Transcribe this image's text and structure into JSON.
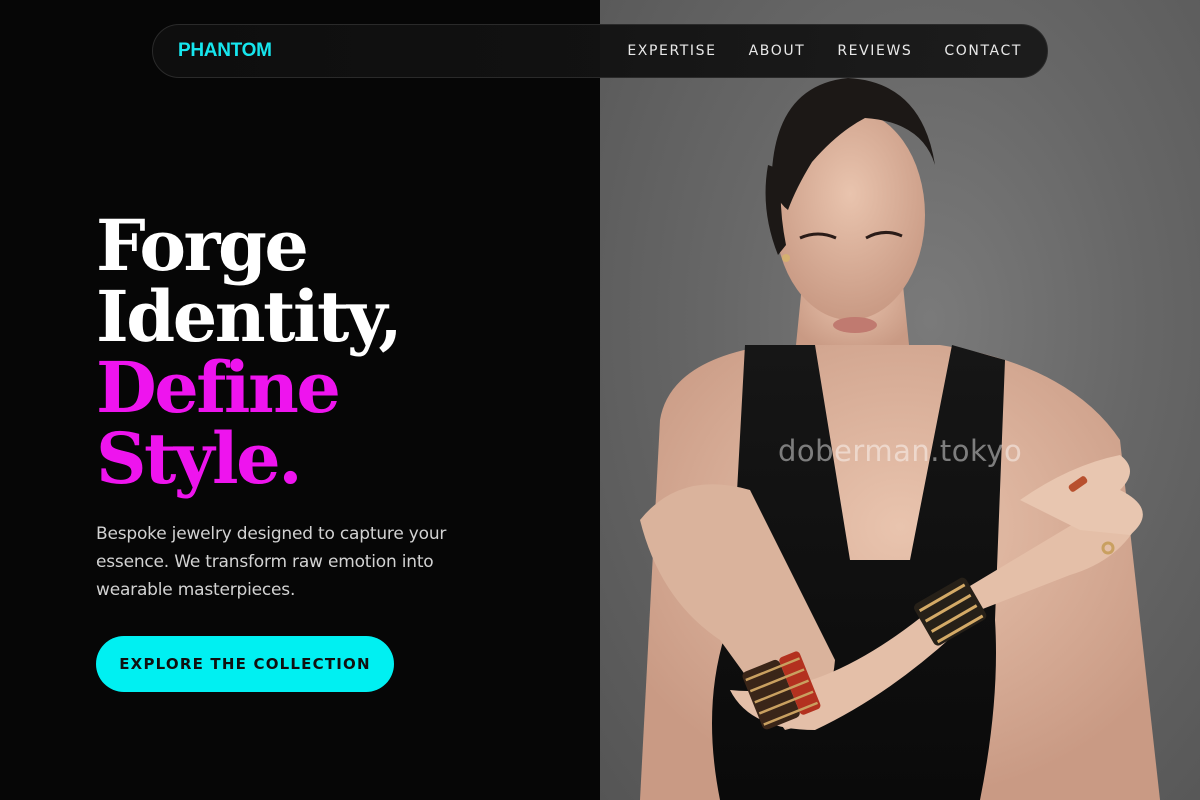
{
  "brand": {
    "name": "PHANTOM",
    "color": "#16e6ee"
  },
  "nav": {
    "links": [
      {
        "label": "EXPERTISE"
      },
      {
        "label": "ABOUT"
      },
      {
        "label": "REVIEWS"
      },
      {
        "label": "CONTACT"
      }
    ]
  },
  "hero": {
    "title_lines": [
      {
        "text": "Forge",
        "color": "white"
      },
      {
        "text": "Identity,",
        "color": "white"
      },
      {
        "text": "Define",
        "color": "magenta"
      },
      {
        "text": "Style.",
        "color": "magenta"
      }
    ],
    "accent_color": "#ee14ee",
    "description": "Bespoke jewelry designed to capture your essence. We transform raw emotion into wearable masterpieces.",
    "cta_label": "EXPLORE THE COLLECTION",
    "cta_color": "#00f0f2"
  },
  "photo": {
    "watermark": "doberman.tokyo",
    "subject": "model-wearing-cuff-bracelets"
  }
}
